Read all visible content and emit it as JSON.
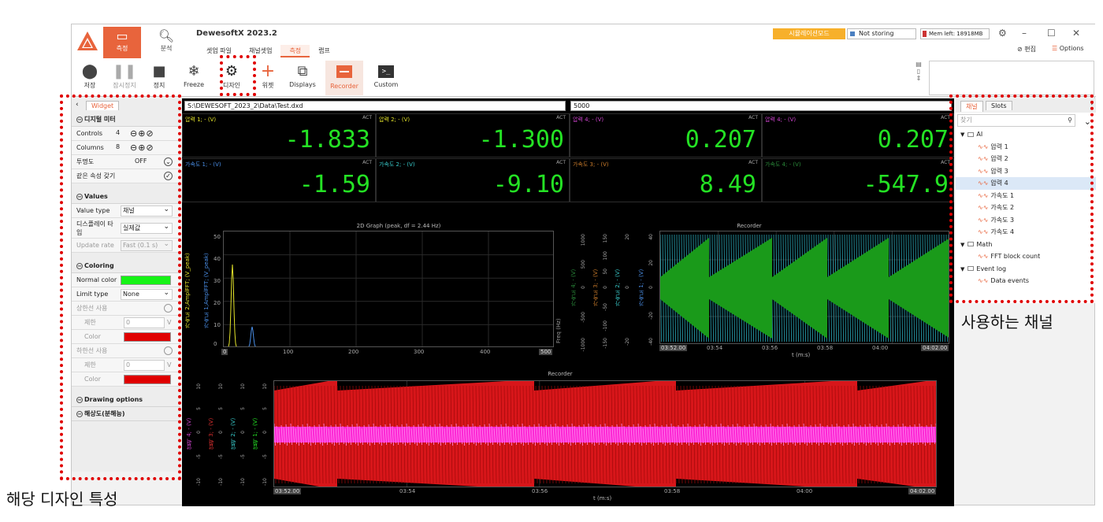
{
  "app": {
    "title": "DewesoftX 2023.2",
    "modes": [
      {
        "label": "측정"
      },
      {
        "label": "분석"
      }
    ],
    "tabs": [
      "셋업 파일",
      "채널셋업",
      "측정",
      "랩프"
    ],
    "active_tab": "측정",
    "simulation_mode": "시뮬레이션모드",
    "storing_status": "Not storing",
    "mem_left": "Mem left: 18918MB",
    "edit_label": "편집",
    "options_label": "Options"
  },
  "toolbar": {
    "buttons": [
      {
        "label": "저장",
        "icon": "record-icon",
        "enabled": true
      },
      {
        "label": "잠시정지",
        "icon": "pause-icon",
        "enabled": false
      },
      {
        "label": "정지",
        "icon": "stop-icon",
        "enabled": true
      },
      {
        "label": "Freeze",
        "icon": "snowflake-icon",
        "enabled": true
      },
      {
        "label": "디자인",
        "icon": "gear-icon",
        "enabled": true
      },
      {
        "label": "위젯",
        "icon": "plus-icon",
        "enabled": true
      },
      {
        "label": "Displays",
        "icon": "displays-icon",
        "enabled": true
      },
      {
        "label": "Recorder",
        "icon": "recorder-icon",
        "enabled": true
      },
      {
        "label": "Custom",
        "icon": "terminal-icon",
        "enabled": true
      }
    ]
  },
  "left_panel": {
    "tab": "Widget",
    "digital_meter": {
      "title": "디지털 미터",
      "controls": {
        "label": "Controls",
        "value": "4"
      },
      "columns": {
        "label": "Columns",
        "value": "8"
      },
      "transparency": {
        "label": "투명도",
        "value": "OFF"
      },
      "same_props": {
        "label": "같은 속성 갖기"
      }
    },
    "values": {
      "title": "Values",
      "value_type": {
        "label": "Value type",
        "value": "채널"
      },
      "display_type": {
        "label": "디스플레이 타입",
        "value": "실제값"
      },
      "update_rate": {
        "label": "Update rate",
        "value": "Fast (0.1 s)"
      }
    },
    "coloring": {
      "title": "Coloring",
      "normal_color": {
        "label": "Normal color",
        "color": "#16f316"
      },
      "limit_type": {
        "label": "Limit type",
        "value": "None"
      },
      "upper": {
        "label": "상한선 사용",
        "limit_label": "제한",
        "limit_value": "0",
        "unit": "V",
        "color_label": "Color",
        "color": "#e00000"
      },
      "lower": {
        "label": "하한선 사용",
        "limit_label": "제한",
        "limit_value": "0",
        "unit": "V",
        "color_label": "Color",
        "color": "#e00000"
      }
    },
    "drawing_options": "Drawing options",
    "resolution": "해상도(분해능)"
  },
  "center": {
    "file_path": "S:\\DEWESOFT_2023_2\\Data\\Test.dxd",
    "sample_count": "5000",
    "meters": [
      {
        "name": "압력 1; - (V)",
        "value": "-1.833",
        "color": "#e3e32a"
      },
      {
        "name": "압력 2; - (V)",
        "value": "-1.300",
        "color": "#e3e32a"
      },
      {
        "name": "압력 4; - (V)",
        "value": "0.207",
        "color": "#d044d0"
      },
      {
        "name": "압력 4; - (V)",
        "value": "0.207",
        "color": "#d044d0"
      },
      {
        "name": "가속도 1; - (V)",
        "value": "-1.59",
        "color": "#4a8fe8"
      },
      {
        "name": "가속도 2; - (V)",
        "value": "-9.10",
        "color": "#37c8c8"
      },
      {
        "name": "가속도 3; - (V)",
        "value": "8.49",
        "color": "#c87a2a"
      },
      {
        "name": "가속도 4; - (V)",
        "value": "-547.9",
        "color": "#2a8a3a"
      }
    ],
    "meter_act": "ACT",
    "graph2d": {
      "title": "2D Graph (peak, df = 2.44 Hz)",
      "xticks": [
        "0",
        "100",
        "200",
        "300",
        "400",
        "500"
      ],
      "x_label": "Freq (Hz)",
      "y_axis_labels": [
        "가속도 2;AmplFFT; (V_peak)",
        "가속도 1;AmplFFT; (V_peak)"
      ],
      "y_ticks": [
        "50",
        "40",
        "30",
        "20",
        "10",
        "0"
      ]
    },
    "recorder1": {
      "title": "Recorder",
      "axes": [
        {
          "label": "가속도 4; - (V)",
          "ticks": [
            "1000",
            "500",
            "0",
            "-500",
            "-1000"
          ]
        },
        {
          "label": "가속도 3; - (V)",
          "ticks": [
            "150",
            "100",
            "50",
            "0",
            "-50",
            "-100",
            "-150"
          ]
        },
        {
          "label": "가속도 2; - (V)",
          "ticks": [
            "20",
            "0",
            "-20"
          ]
        },
        {
          "label": "가속도 1; - (V)",
          "ticks": [
            "40",
            "20",
            "0",
            "-20",
            "-40"
          ]
        }
      ],
      "xticks": [
        "03:52.00",
        "03:54",
        "03:56",
        "03:58",
        "04:00",
        "04:02.00"
      ],
      "x_label": "t (m:s)"
    },
    "recorder2": {
      "title": "Recorder",
      "axes": [
        {
          "label": "압력 4; - (V)"
        },
        {
          "label": "압력 3; - (V)"
        },
        {
          "label": "압력 2; - (V)"
        },
        {
          "label": "압력 1; - (V)"
        }
      ],
      "y_ticks": [
        "10",
        "5",
        "0",
        "-5",
        "-10"
      ],
      "xticks": [
        "03:52.00",
        "03:54",
        "03:56",
        "03:58",
        "04:00",
        "04:02.00"
      ],
      "x_label": "t (m:s)"
    }
  },
  "right_panel": {
    "tabs": [
      "채널",
      "Slots"
    ],
    "search_placeholder": "찾기",
    "tree": [
      {
        "type": "group",
        "label": "AI"
      },
      {
        "type": "chan",
        "label": "압력 1"
      },
      {
        "type": "chan",
        "label": "압력 2"
      },
      {
        "type": "chan",
        "label": "압력 3"
      },
      {
        "type": "chan",
        "label": "압력 4",
        "selected": true
      },
      {
        "type": "chan",
        "label": "가속도 1"
      },
      {
        "type": "chan",
        "label": "가속도 2"
      },
      {
        "type": "chan",
        "label": "가속도 3"
      },
      {
        "type": "chan",
        "label": "가속도 4"
      },
      {
        "type": "group",
        "label": "Math"
      },
      {
        "type": "chan",
        "label": "FFT block count"
      },
      {
        "type": "group",
        "label": "Event log"
      },
      {
        "type": "chan",
        "label": "Data events"
      }
    ]
  },
  "annotations": {
    "design_props": "해당 디자인 특성",
    "used_channels": "사용하는 채널"
  }
}
